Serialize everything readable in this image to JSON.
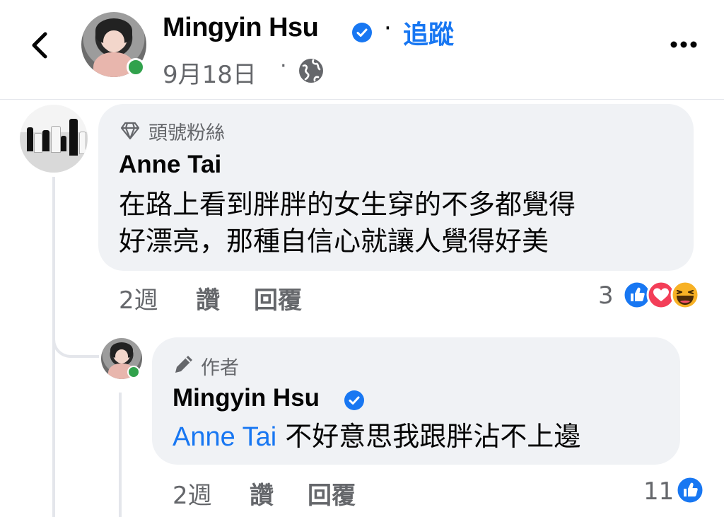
{
  "header": {
    "back_icon": "chevron-left-icon",
    "name": "Mingyin Hsu",
    "verified_icon": "verified-badge-icon",
    "separator": "·",
    "follow_label": "追蹤",
    "date": "9月18日",
    "privacy_icon": "globe-icon",
    "more_icon": "more-horizontal-icon"
  },
  "comments": [
    {
      "badge": "頭號粉絲",
      "badge_icon": "diamond-icon",
      "author": "Anne Tai",
      "text_lines": [
        "在路上看到胖胖的女生穿的不多都覺得",
        "好漂亮，那種自信心就讓人覺得好美"
      ],
      "time": "2週",
      "like_label": "讚",
      "reply_label": "回覆",
      "reaction_count": "3",
      "reaction_icons": [
        "like-reaction-icon",
        "love-reaction-icon",
        "haha-reaction-icon"
      ]
    },
    {
      "badge": "作者",
      "badge_icon": "pencil-icon",
      "author": "Mingyin Hsu",
      "mention": "Anne Tai",
      "text": " 不好意思我跟胖沾不上邊",
      "time": "2週",
      "like_label": "讚",
      "reply_label": "回覆",
      "reaction_count": "11",
      "reaction_icons": [
        "like-reaction-icon"
      ]
    }
  ],
  "colors": {
    "accent": "#1877f2",
    "secondary_text": "#65676b",
    "bubble": "#f0f2f5",
    "online": "#31a24c",
    "love": "#f33e58",
    "haha": "#f7b125"
  }
}
